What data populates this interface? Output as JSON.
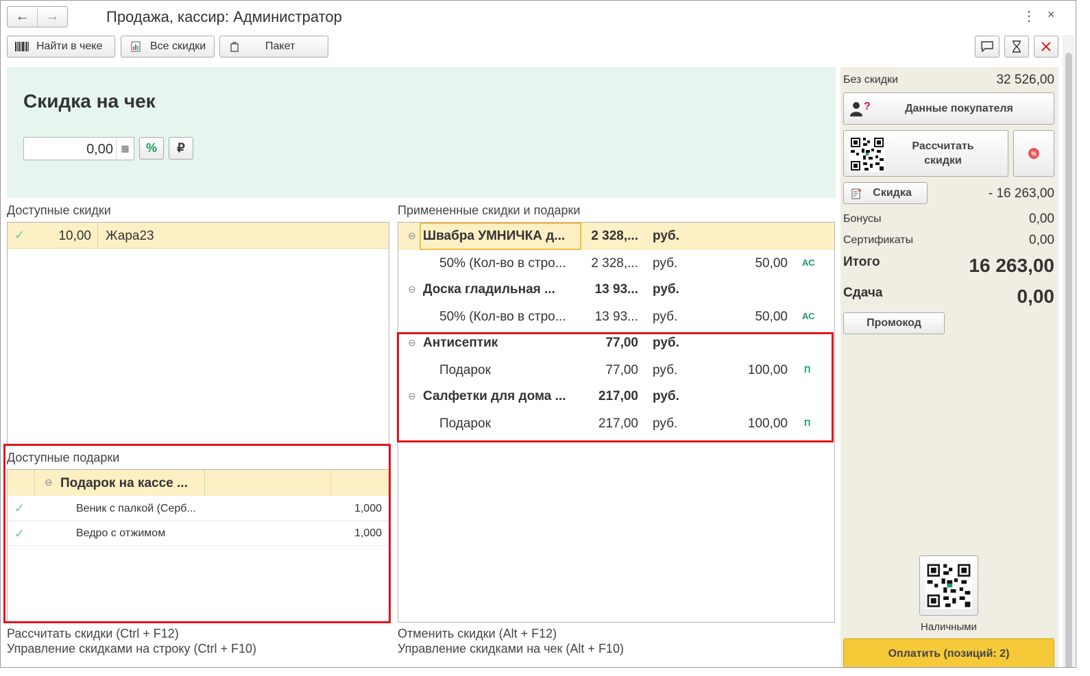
{
  "window": {
    "title": "Продажа, кассир: Администратор",
    "back_icon": "arrow-left",
    "forward_icon": "arrow-right",
    "more_icon": "⋮",
    "close_icon": "×"
  },
  "toolbar": {
    "find_label": "Найти в чеке",
    "all_discounts_label": "Все скидки",
    "package_label": "Пакет"
  },
  "discount_panel": {
    "title": "Скидка на чек",
    "amount_value": "0,00",
    "percent_label": "%",
    "ruble_label": "₽"
  },
  "available_discounts": {
    "label": "Доступные скидки",
    "rows": [
      {
        "value": "10,00",
        "name": "Жара23"
      }
    ]
  },
  "available_gifts": {
    "label": "Доступные подарки",
    "group": "Подарок на кассе ...",
    "rows": [
      {
        "name": "Веник с палкой (Серб...",
        "qty": "1,000"
      },
      {
        "name": "Ведро с отжимом",
        "qty": "1,000"
      }
    ]
  },
  "applied": {
    "label": "Примененные скидки и подарки",
    "rows": [
      {
        "type": "group",
        "name": "Швабра УМНИЧКА д...",
        "amount": "2 328,...",
        "currency": "руб.",
        "percent": "",
        "tag": ""
      },
      {
        "type": "item",
        "name": "50% (Кол-во в стро...",
        "amount": "2 328,...",
        "currency": "руб.",
        "percent": "50,00",
        "tag": "АС"
      },
      {
        "type": "group",
        "name": "Доска гладильная ...",
        "amount": "13 93...",
        "currency": "руб.",
        "percent": "",
        "tag": ""
      },
      {
        "type": "item",
        "name": "50% (Кол-во в стро...",
        "amount": "13 93...",
        "currency": "руб.",
        "percent": "50,00",
        "tag": "АС"
      },
      {
        "type": "group",
        "name": "Антисептик",
        "amount": "77,00",
        "currency": "руб.",
        "percent": "",
        "tag": ""
      },
      {
        "type": "item",
        "name": "Подарок",
        "amount": "77,00",
        "currency": "руб.",
        "percent": "100,00",
        "tag": "П"
      },
      {
        "type": "group",
        "name": "Салфетки для дома ...",
        "amount": "217,00",
        "currency": "руб.",
        "percent": "",
        "tag": ""
      },
      {
        "type": "item",
        "name": "Подарок",
        "amount": "217,00",
        "currency": "руб.",
        "percent": "100,00",
        "tag": "П"
      }
    ]
  },
  "links": {
    "calc_discounts": "Рассчитать скидки (Ctrl + F12)",
    "manage_row": "Управление скидками на строку (Ctrl + F10)",
    "cancel_discounts": "Отменить скидки (Alt + F12)",
    "manage_check": "Управление скидками на чек (Alt + F10)"
  },
  "summary": {
    "no_discount_label": "Без скидки",
    "no_discount_value": "32 526,00",
    "buyer_data_label": "Данные покупателя",
    "calc_discounts_label": "Рассчитать скидки",
    "discount_label": "Скидка",
    "discount_value": "- 16 263,00",
    "bonuses_label": "Бонусы",
    "bonuses_value": "0,00",
    "certificates_label": "Сертификаты",
    "certificates_value": "0,00",
    "total_label": "Итого",
    "total_value": "16 263,00",
    "change_label": "Сдача",
    "change_value": "0,00",
    "promo_label": "Промокод",
    "cash_label": "Наличными",
    "pay_label": "Оплатить (позиций: 2)"
  },
  "colors": {
    "panel_green": "#e6f5ee",
    "highlight_yellow": "#fdf0c4",
    "right_panel": "#f0ede2",
    "pay_button": "#f5c938",
    "red_frame": "#e0141e",
    "tag_green": "#1c9c60"
  }
}
